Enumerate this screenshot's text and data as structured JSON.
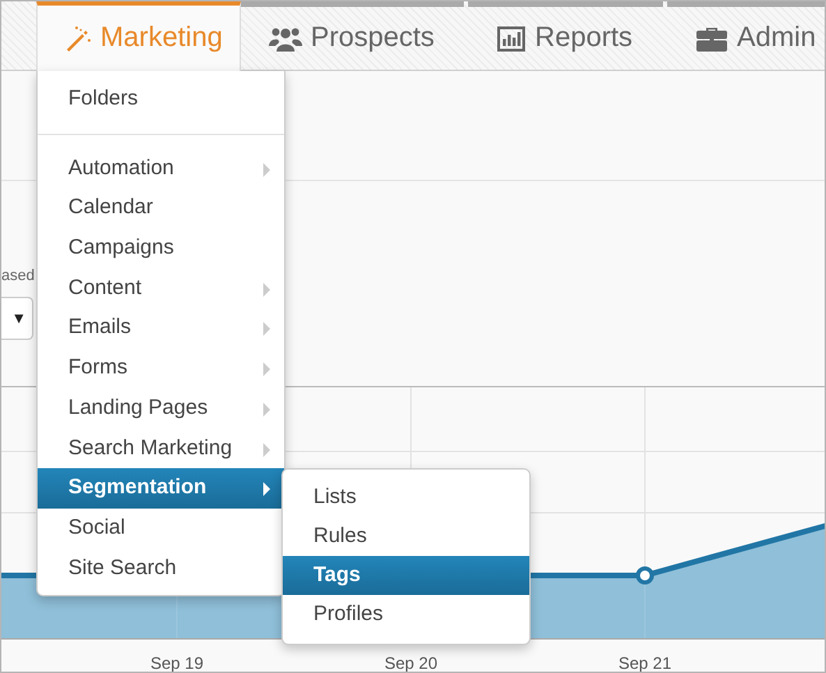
{
  "nav_tabs": [
    {
      "label": "Marketing",
      "selected": true
    },
    {
      "label": "Prospects",
      "selected": false
    },
    {
      "label": "Reports",
      "selected": false
    },
    {
      "label": "Admin",
      "selected": false
    }
  ],
  "page": {
    "caption": "ased",
    "select_caret": "▼"
  },
  "chart": {
    "x_labels": [
      "Sep 19",
      "Sep 20",
      "Sep 21"
    ]
  },
  "menu": {
    "items": [
      {
        "kind": "item",
        "label": "Folders",
        "has_submenu": false,
        "selected": false
      },
      {
        "kind": "divider"
      },
      {
        "kind": "item",
        "label": "Automation",
        "has_submenu": true,
        "selected": false
      },
      {
        "kind": "item",
        "label": "Calendar",
        "has_submenu": false,
        "selected": false
      },
      {
        "kind": "item",
        "label": "Campaigns",
        "has_submenu": false,
        "selected": false
      },
      {
        "kind": "item",
        "label": "Content",
        "has_submenu": true,
        "selected": false
      },
      {
        "kind": "item",
        "label": "Emails",
        "has_submenu": true,
        "selected": false
      },
      {
        "kind": "item",
        "label": "Forms",
        "has_submenu": true,
        "selected": false
      },
      {
        "kind": "item",
        "label": "Landing Pages",
        "has_submenu": true,
        "selected": false
      },
      {
        "kind": "item",
        "label": "Search Marketing",
        "has_submenu": true,
        "selected": false
      },
      {
        "kind": "item",
        "label": "Segmentation",
        "has_submenu": true,
        "selected": true
      },
      {
        "kind": "item",
        "label": "Social",
        "has_submenu": false,
        "selected": false
      },
      {
        "kind": "item",
        "label": "Site Search",
        "has_submenu": false,
        "selected": false
      }
    ]
  },
  "submenu": {
    "items": [
      {
        "label": "Lists",
        "selected": false
      },
      {
        "label": "Rules",
        "selected": false
      },
      {
        "label": "Tags",
        "selected": true
      },
      {
        "label": "Profiles",
        "selected": false
      }
    ]
  }
}
